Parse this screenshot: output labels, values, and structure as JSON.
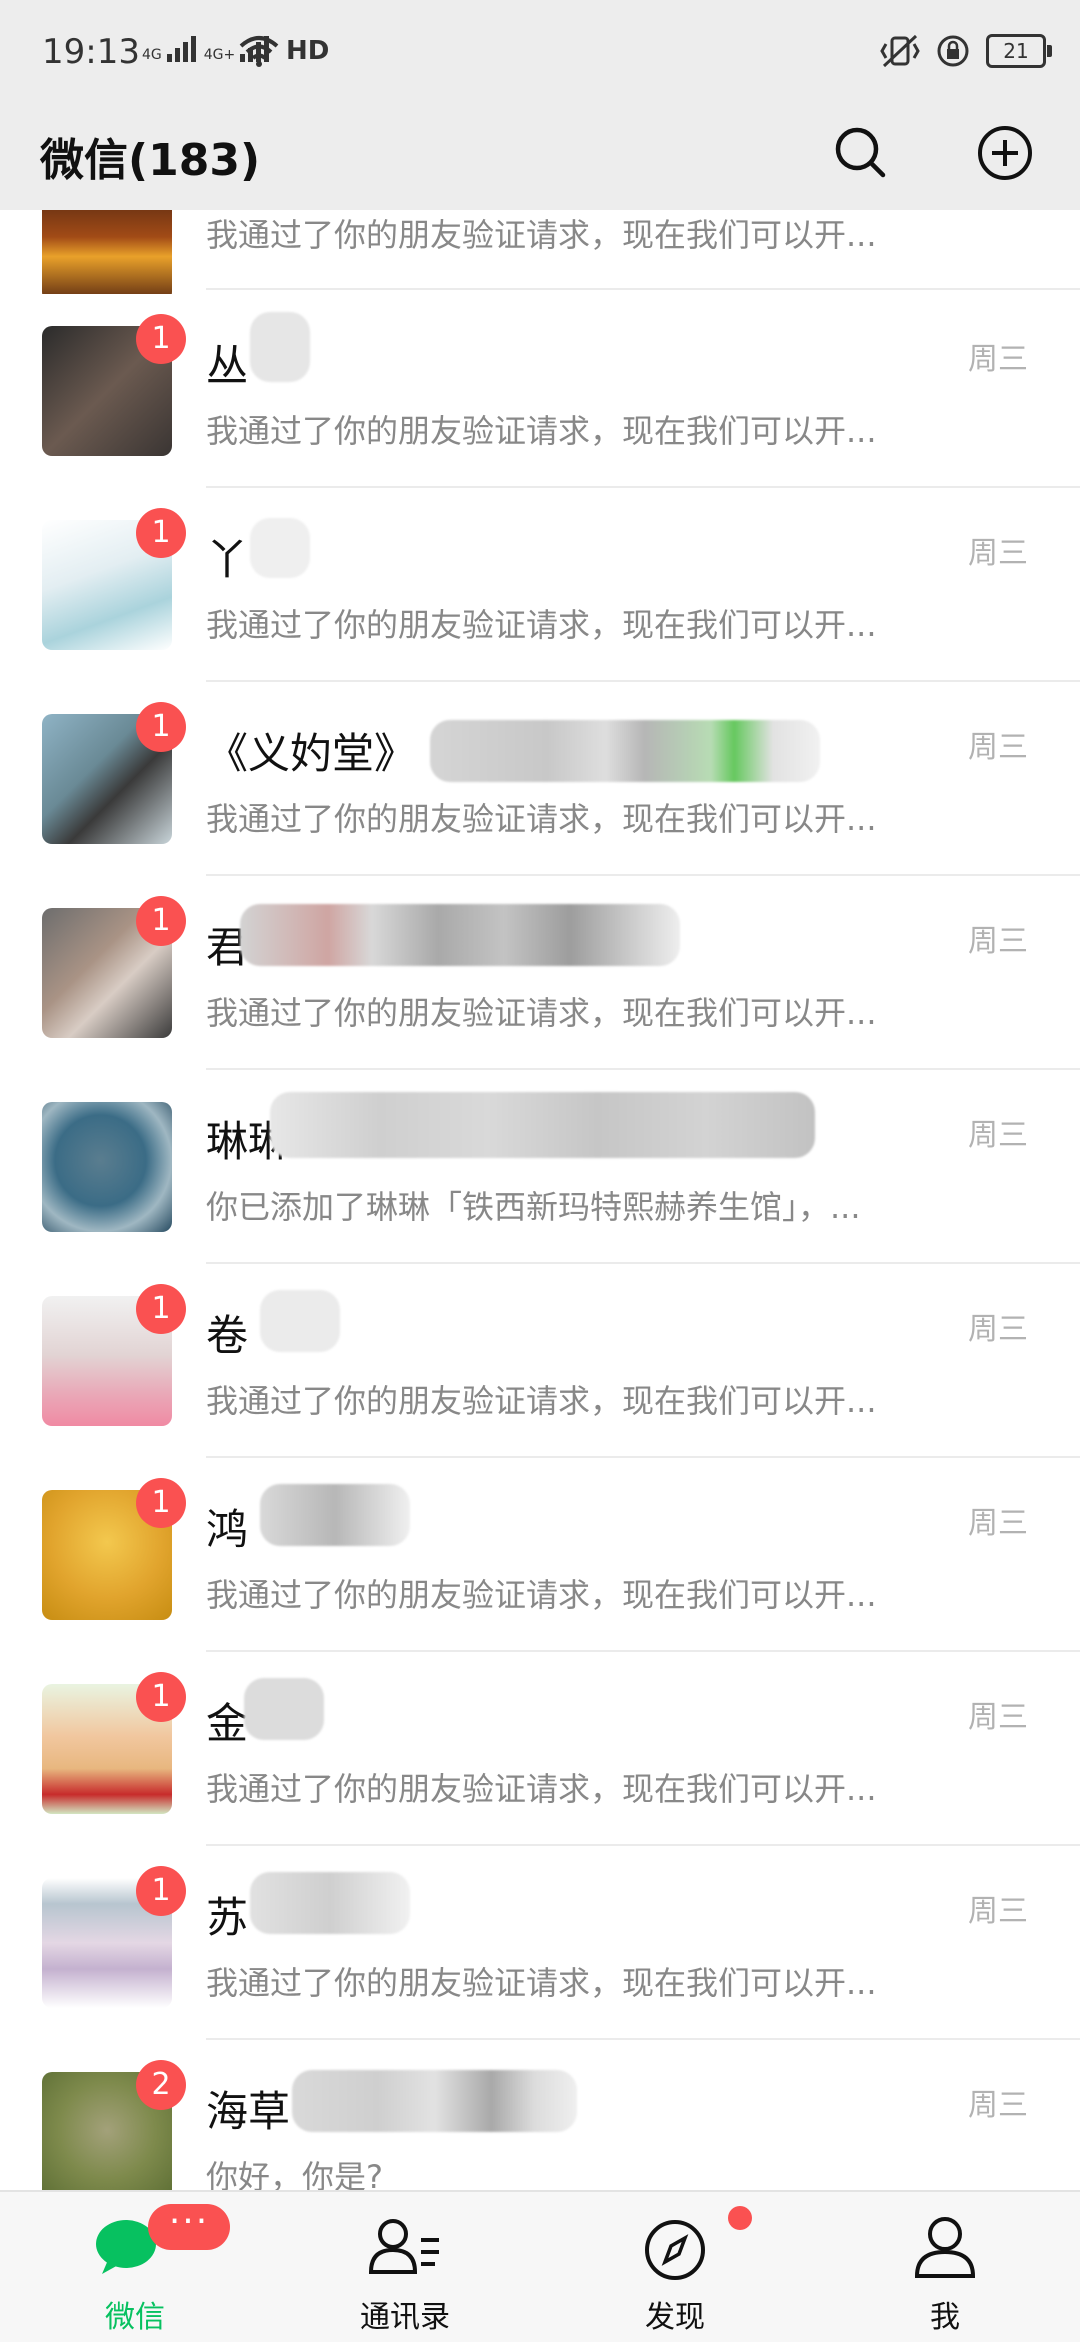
{
  "status_bar": {
    "time": "19:13",
    "network_1": "4G",
    "network_2": "4G+",
    "hd_label": "HD",
    "battery": "21"
  },
  "header": {
    "title": "微信(183)"
  },
  "partial_row": {
    "preview": "我通过了你的朋友验证请求，现在我们可以开..."
  },
  "chats": [
    {
      "name": "丛",
      "preview": "我通过了你的朋友验证请求，现在我们可以开...",
      "time": "周三",
      "badge": "1"
    },
    {
      "name": "丫",
      "preview": "我通过了你的朋友验证请求，现在我们可以开...",
      "time": "周三",
      "badge": "1"
    },
    {
      "name": "《义妁堂》",
      "preview": "我通过了你的朋友验证请求，现在我们可以开...",
      "time": "周三",
      "badge": "1"
    },
    {
      "name": "君",
      "preview": "我通过了你的朋友验证请求，现在我们可以开...",
      "time": "周三",
      "badge": "1"
    },
    {
      "name": "琳琳",
      "preview": "你已添加了琳琳「铁西新玛特熙赫养生馆」，...",
      "time": "周三",
      "badge": ""
    },
    {
      "name": "卷",
      "preview": "我通过了你的朋友验证请求，现在我们可以开...",
      "time": "周三",
      "badge": "1"
    },
    {
      "name": "鸿",
      "preview": "我通过了你的朋友验证请求，现在我们可以开...",
      "time": "周三",
      "badge": "1"
    },
    {
      "name": "金",
      "preview": "我通过了你的朋友验证请求，现在我们可以开...",
      "time": "周三",
      "badge": "1"
    },
    {
      "name": "苏",
      "preview": "我通过了你的朋友验证请求，现在我们可以开...",
      "time": "周三",
      "badge": "1"
    },
    {
      "name": "海草",
      "preview": "你好，你是?",
      "time": "周三",
      "badge": "2"
    }
  ],
  "tabs": {
    "wechat": "微信",
    "contacts": "通讯录",
    "discover": "发现",
    "me": "我",
    "more_badge": "···"
  },
  "colors": {
    "accent": "#07c160",
    "badge": "#fa5151",
    "header_bg": "#ededed"
  }
}
